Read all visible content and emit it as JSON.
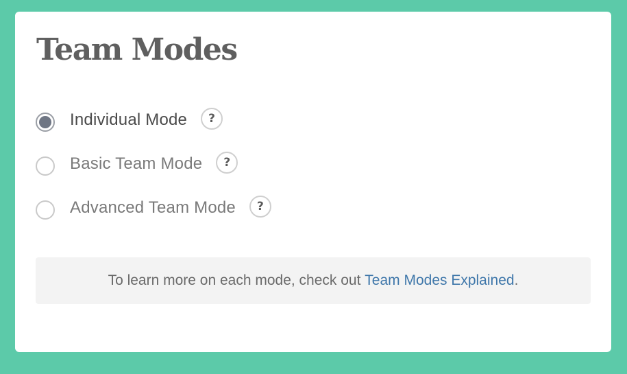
{
  "card": {
    "title": "Team Modes"
  },
  "modes": [
    {
      "label": "Individual Mode",
      "selected": true,
      "help_glyph": "?"
    },
    {
      "label": "Basic Team Mode",
      "selected": false,
      "help_glyph": "?"
    },
    {
      "label": "Advanced Team Mode",
      "selected": false,
      "help_glyph": "?"
    }
  ],
  "info": {
    "prefix": "To learn more on each mode, check out ",
    "link_text": "Team Modes Explained",
    "suffix": "."
  },
  "colors": {
    "background": "#5ccaa9",
    "card": "#ffffff",
    "link": "#3f77aa",
    "radio_selected_fill": "#6f7684"
  },
  "icons": {
    "help": "question-mark-icon"
  }
}
